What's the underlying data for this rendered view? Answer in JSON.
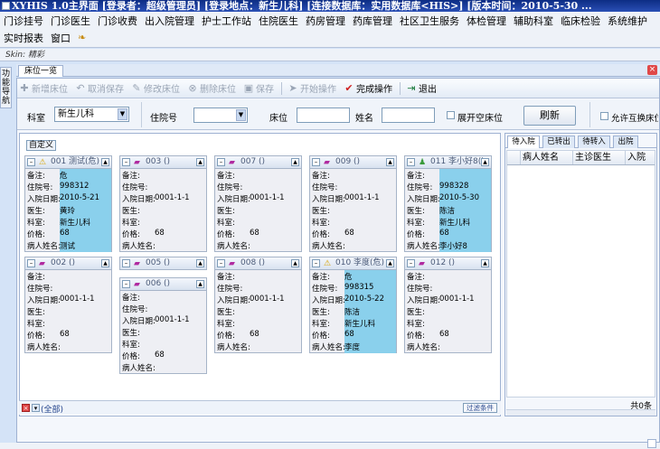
{
  "window": {
    "title": "XYHIS 1.0主界面  [登录者：超级管理员] [登录地点：新生儿科] [连接数据库：实用数据库<HIS>] [版本时间：2010-5-30 ..."
  },
  "menu": {
    "row1": [
      "门诊挂号",
      "门诊医生",
      "门诊收费",
      "出入院管理",
      "护士工作站",
      "住院医生",
      "药房管理",
      "药库管理",
      "社区卫生服务",
      "体检管理",
      "辅助科室",
      "临床检验",
      "系统维护"
    ],
    "row2": [
      "实时报表",
      "窗口"
    ],
    "logo_icon": "app-logo-icon"
  },
  "skin": "Skin: 精彩",
  "side_tab": "功能导航",
  "doc_tab": "床位一览",
  "toolbar": {
    "add": "新增床位",
    "cancel": "取消保存",
    "edit": "修改床位",
    "delete": "删除床位",
    "save": "保存",
    "start": "开始操作",
    "finish": "完成操作",
    "exit": "退出"
  },
  "filter": {
    "dept_label": "科室",
    "dept_value": "新生儿科",
    "admission_label": "住院号",
    "bed_label": "床位",
    "name_label": "姓名",
    "expand_empty": "展开空床位",
    "refresh": "刷新",
    "allow_swap": "允许互换床位"
  },
  "bed_panel": {
    "custom": "自定义",
    "footer_all": "(全部)",
    "footer_filter": "过滤条件",
    "field_labels": {
      "remark": "备注:",
      "admission_no": "住院号:",
      "admit_date": "入院日期:",
      "doctor": "医生:",
      "dept": "科室:",
      "price": "价格:",
      "patient": "病人姓名:"
    },
    "beds": [
      {
        "title": "001 测试(危)",
        "icon": "warning-icon",
        "remark": "危",
        "admission_no": "998312",
        "admit_date": "2010-5-21",
        "doctor": "黄玲",
        "dept": "新生儿科",
        "price": "68",
        "patient": "测试",
        "occupied": true
      },
      {
        "title": "003 ()",
        "icon": "bed-icon",
        "remark": "",
        "admission_no": "",
        "admit_date": "0001-1-1",
        "doctor": "",
        "dept": "",
        "price": "68",
        "patient": "",
        "occupied": false
      },
      {
        "title": "007 ()",
        "icon": "bed-icon",
        "remark": "",
        "admission_no": "",
        "admit_date": "0001-1-1",
        "doctor": "",
        "dept": "",
        "price": "68",
        "patient": "",
        "occupied": false
      },
      {
        "title": "009 ()",
        "icon": "bed-icon",
        "remark": "",
        "admission_no": "",
        "admit_date": "0001-1-1",
        "doctor": "",
        "dept": "",
        "price": "68",
        "patient": "",
        "occupied": false
      },
      {
        "title": "011 李小好8()",
        "icon": "person-icon",
        "remark": "",
        "admission_no": "998328",
        "admit_date": "2010-5-30",
        "doctor": "陈洁",
        "dept": "新生儿科",
        "price": "68",
        "patient": "李小好8",
        "occupied": true
      },
      {
        "title": "002 ()",
        "icon": "bed-icon",
        "remark": "",
        "admission_no": "",
        "admit_date": "0001-1-1",
        "doctor": "",
        "dept": "",
        "price": "68",
        "patient": "",
        "occupied": false
      },
      {
        "title": "005 ()",
        "icon": "bed-icon",
        "remark": "",
        "admission_no": "",
        "admit_date": "",
        "doctor": "",
        "dept": "",
        "price": "",
        "patient": "",
        "occupied": false,
        "collapsed": true
      },
      {
        "title": "006 ()",
        "icon": "bed-icon",
        "remark": "",
        "admission_no": "",
        "admit_date": "0001-1-1",
        "doctor": "",
        "dept": "",
        "price": "68",
        "patient": "",
        "occupied": false
      },
      {
        "title": "008 ()",
        "icon": "bed-icon",
        "remark": "",
        "admission_no": "",
        "admit_date": "0001-1-1",
        "doctor": "",
        "dept": "",
        "price": "68",
        "patient": "",
        "occupied": false
      },
      {
        "title": "010 李度(危)",
        "icon": "warning-icon",
        "remark": "危",
        "admission_no": "998315",
        "admit_date": "2010-5-22",
        "doctor": "陈洁",
        "dept": "新生儿科",
        "price": "68",
        "patient": "李度",
        "occupied": true
      },
      {
        "title": "012 ()",
        "icon": "bed-icon",
        "remark": "",
        "admission_no": "",
        "admit_date": "0001-1-1",
        "doctor": "",
        "dept": "",
        "price": "68",
        "patient": "",
        "occupied": false
      }
    ]
  },
  "right_panel": {
    "tabs": [
      "待入院",
      "已转出",
      "待转入",
      "出院"
    ],
    "columns": [
      "病人姓名",
      "主诊医生",
      "入院"
    ],
    "total": "共0条"
  }
}
